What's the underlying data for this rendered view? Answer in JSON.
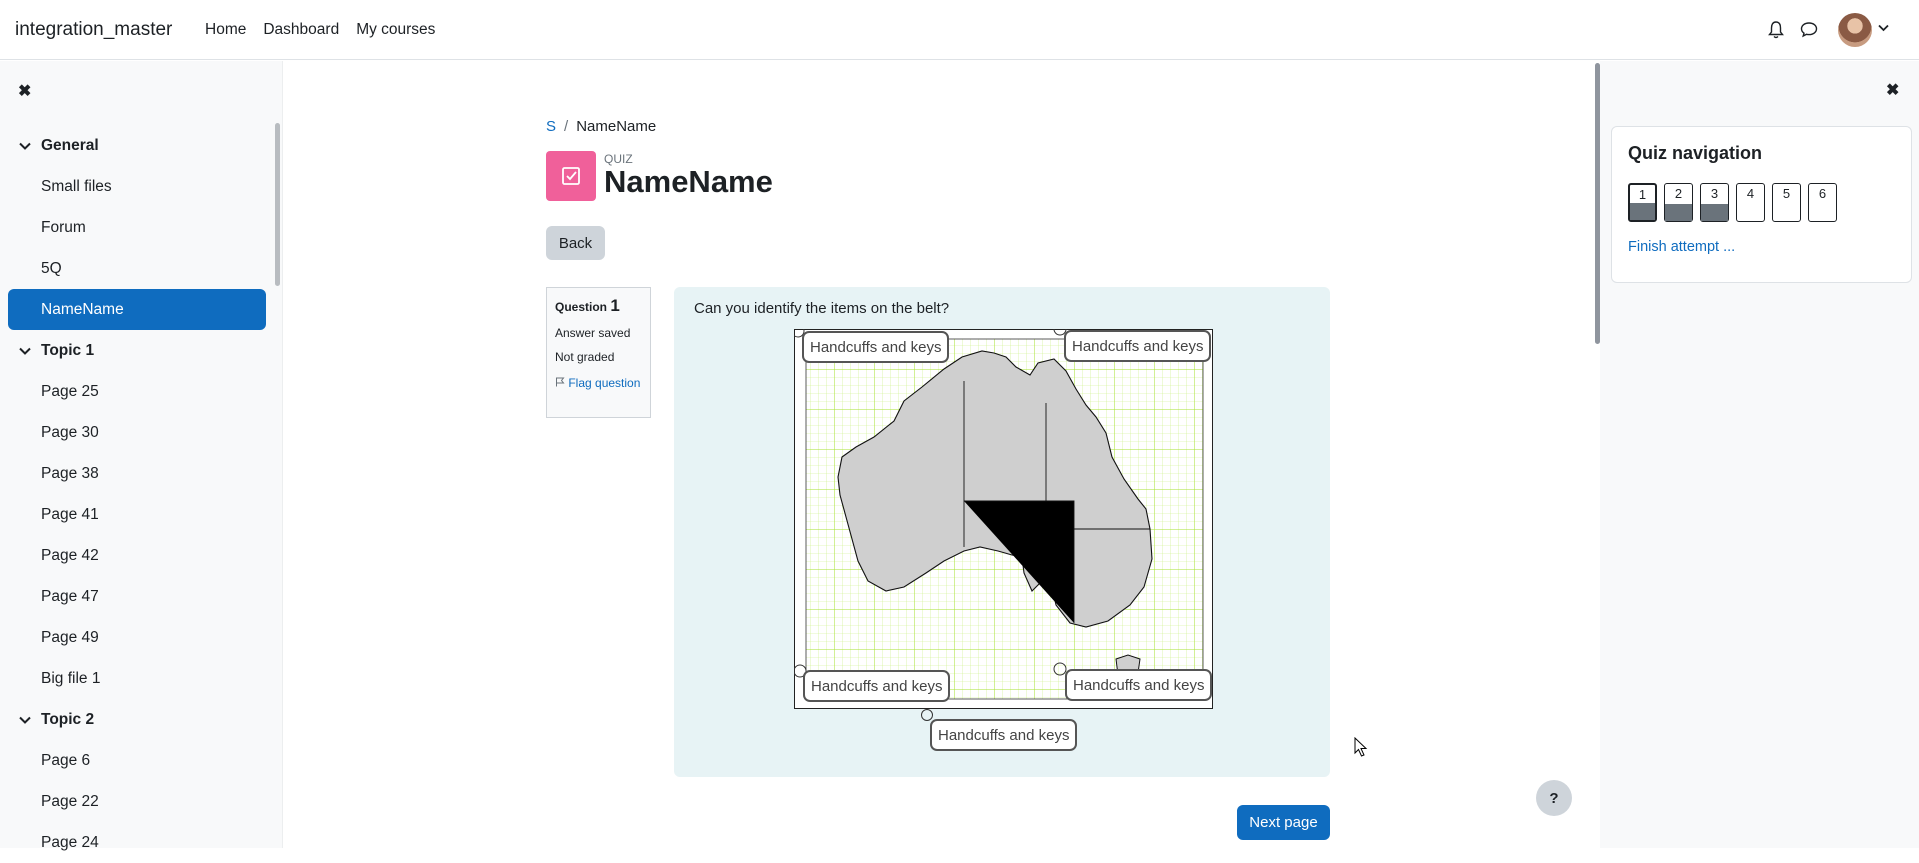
{
  "topbar": {
    "brand": "integration_master",
    "nav": [
      "Home",
      "Dashboard",
      "My courses"
    ]
  },
  "drawer": {
    "sections": [
      {
        "title": "General",
        "items": [
          {
            "label": "Small files",
            "active": false
          },
          {
            "label": "Forum",
            "active": false
          },
          {
            "label": "5Q",
            "active": false
          },
          {
            "label": "NameName",
            "active": true
          }
        ]
      },
      {
        "title": "Topic 1",
        "items": [
          {
            "label": "Page 25",
            "active": false
          },
          {
            "label": "Page 30",
            "active": false
          },
          {
            "label": "Page 38",
            "active": false
          },
          {
            "label": "Page 41",
            "active": false
          },
          {
            "label": "Page 42",
            "active": false
          },
          {
            "label": "Page 47",
            "active": false
          },
          {
            "label": "Page 49",
            "active": false
          },
          {
            "label": "Big file 1",
            "active": false
          }
        ]
      },
      {
        "title": "Topic 2",
        "items": [
          {
            "label": "Page 6",
            "active": false
          },
          {
            "label": "Page 22",
            "active": false
          },
          {
            "label": "Page 24",
            "active": false
          }
        ]
      }
    ]
  },
  "breadcrumb": {
    "root": "S",
    "separator": "/",
    "current": "NameName"
  },
  "activity": {
    "type_label": "QUIZ",
    "title": "NameName"
  },
  "back_label": "Back",
  "question": {
    "label": "Question",
    "number": "1",
    "status": "Answer saved",
    "grade": "Not graded",
    "flag_label": "Flag question",
    "text": "Can you identify the items on the belt?",
    "drag_items": [
      "Handcuffs and keys",
      "Handcuffs and keys",
      "Handcuffs and keys",
      "Handcuffs and keys",
      "Handcuffs and keys"
    ]
  },
  "next_label": "Next page",
  "help_label": "?",
  "quiz_nav": {
    "title": "Quiz navigation",
    "questions": [
      {
        "num": "1",
        "answered": true,
        "current": true
      },
      {
        "num": "2",
        "answered": true,
        "current": false
      },
      {
        "num": "3",
        "answered": true,
        "current": false
      },
      {
        "num": "4",
        "answered": false,
        "current": false
      },
      {
        "num": "5",
        "answered": false,
        "current": false
      },
      {
        "num": "6",
        "answered": false,
        "current": false
      }
    ],
    "finish_label": "Finish attempt ..."
  },
  "colors": {
    "primary": "#0f6cbf",
    "quiz_icon": "#f0609a",
    "question_bg": "#e7f3f5",
    "map_fill": "#cfcfcf",
    "grid": "#a6e22e"
  }
}
